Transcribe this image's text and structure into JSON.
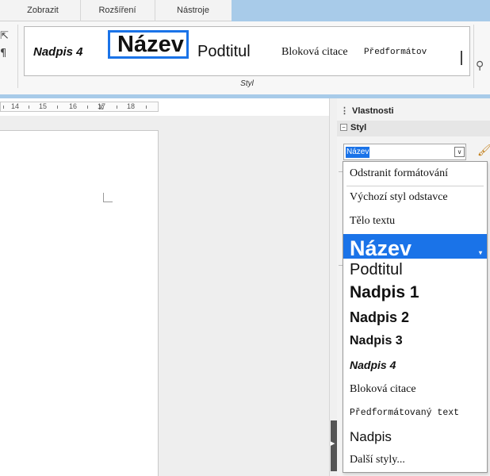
{
  "tabs": [
    "Zobrazit",
    "Rozšíření",
    "Nástroje"
  ],
  "ribbon": {
    "gallery": [
      "Nadpis 4",
      "Název",
      "Podtitul",
      "Bloková citace",
      "Předformátov"
    ],
    "group_label": "Styl"
  },
  "ruler": [
    "14",
    "15",
    "16",
    "17",
    "18"
  ],
  "sidebar": {
    "title": "Vlastnosti",
    "section": "Styl",
    "combo_value": "Název"
  },
  "dropdown": {
    "items": [
      "Odstranit formátování",
      "Výchozí styl odstavce",
      "Tělo textu",
      "Název",
      "Podtitul",
      "Nadpis 1",
      "Nadpis 2",
      "Nadpis 3",
      "Nadpis 4",
      "Bloková citace",
      "Předformátovaný text",
      "Nadpis",
      "Další styly..."
    ],
    "selected": "Název"
  },
  "colors": {
    "accent": "#1a73e8",
    "tabbar": "#a8cbe9"
  },
  "icons": [
    "formatting-marks-icon",
    "pilcrow-icon",
    "find-replace-icon",
    "chevron-down-icon",
    "new-style-brush-icon",
    "panel-grip-icon",
    "collapse-minus-icon"
  ]
}
